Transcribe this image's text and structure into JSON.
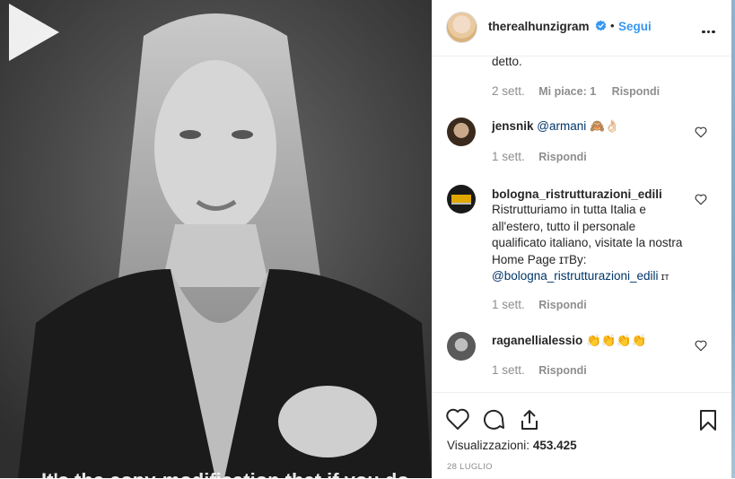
{
  "video": {
    "caption_overlay": "It's the copy-modification that if you do"
  },
  "header": {
    "username": "therealhunzigram",
    "separator": "•",
    "follow_label": "Segui"
  },
  "comments": [
    {
      "text": "detto.",
      "time": "2 sett.",
      "likes": "Mi piace: 1",
      "reply": "Rispondi"
    },
    {
      "username": "jensnik",
      "text": "@armani 🙈👌🏻",
      "time": "1 sett.",
      "reply": "Rispondi"
    },
    {
      "username": "bologna_ristrutturazioni_edili",
      "text": "Ristrutturiamo in tutta Italia e all'estero, tutto il personale qualificato italiano, visitate la nostra Home Page ɪᴛBy:",
      "mention": "@bologna_ristrutturazioni_edili",
      "suffix": " ɪᴛ",
      "time": "1 sett.",
      "reply": "Rispondi"
    },
    {
      "username": "raganellialessio",
      "text": "👏👏👏👏",
      "time": "1 sett.",
      "reply": "Rispondi"
    }
  ],
  "footer": {
    "views_label": "Visualizzazioni:",
    "views_count": "453.425",
    "date": "28 LUGLIO"
  },
  "icons": {
    "like": "heart-icon",
    "comment": "comment-icon",
    "share": "share-icon",
    "save": "bookmark-icon",
    "more": "more-options-icon",
    "play": "play-icon",
    "verified": "verified-badge-icon"
  },
  "colors": {
    "link_blue": "#3897f0",
    "text": "#262626",
    "muted": "#8e8e8e"
  }
}
